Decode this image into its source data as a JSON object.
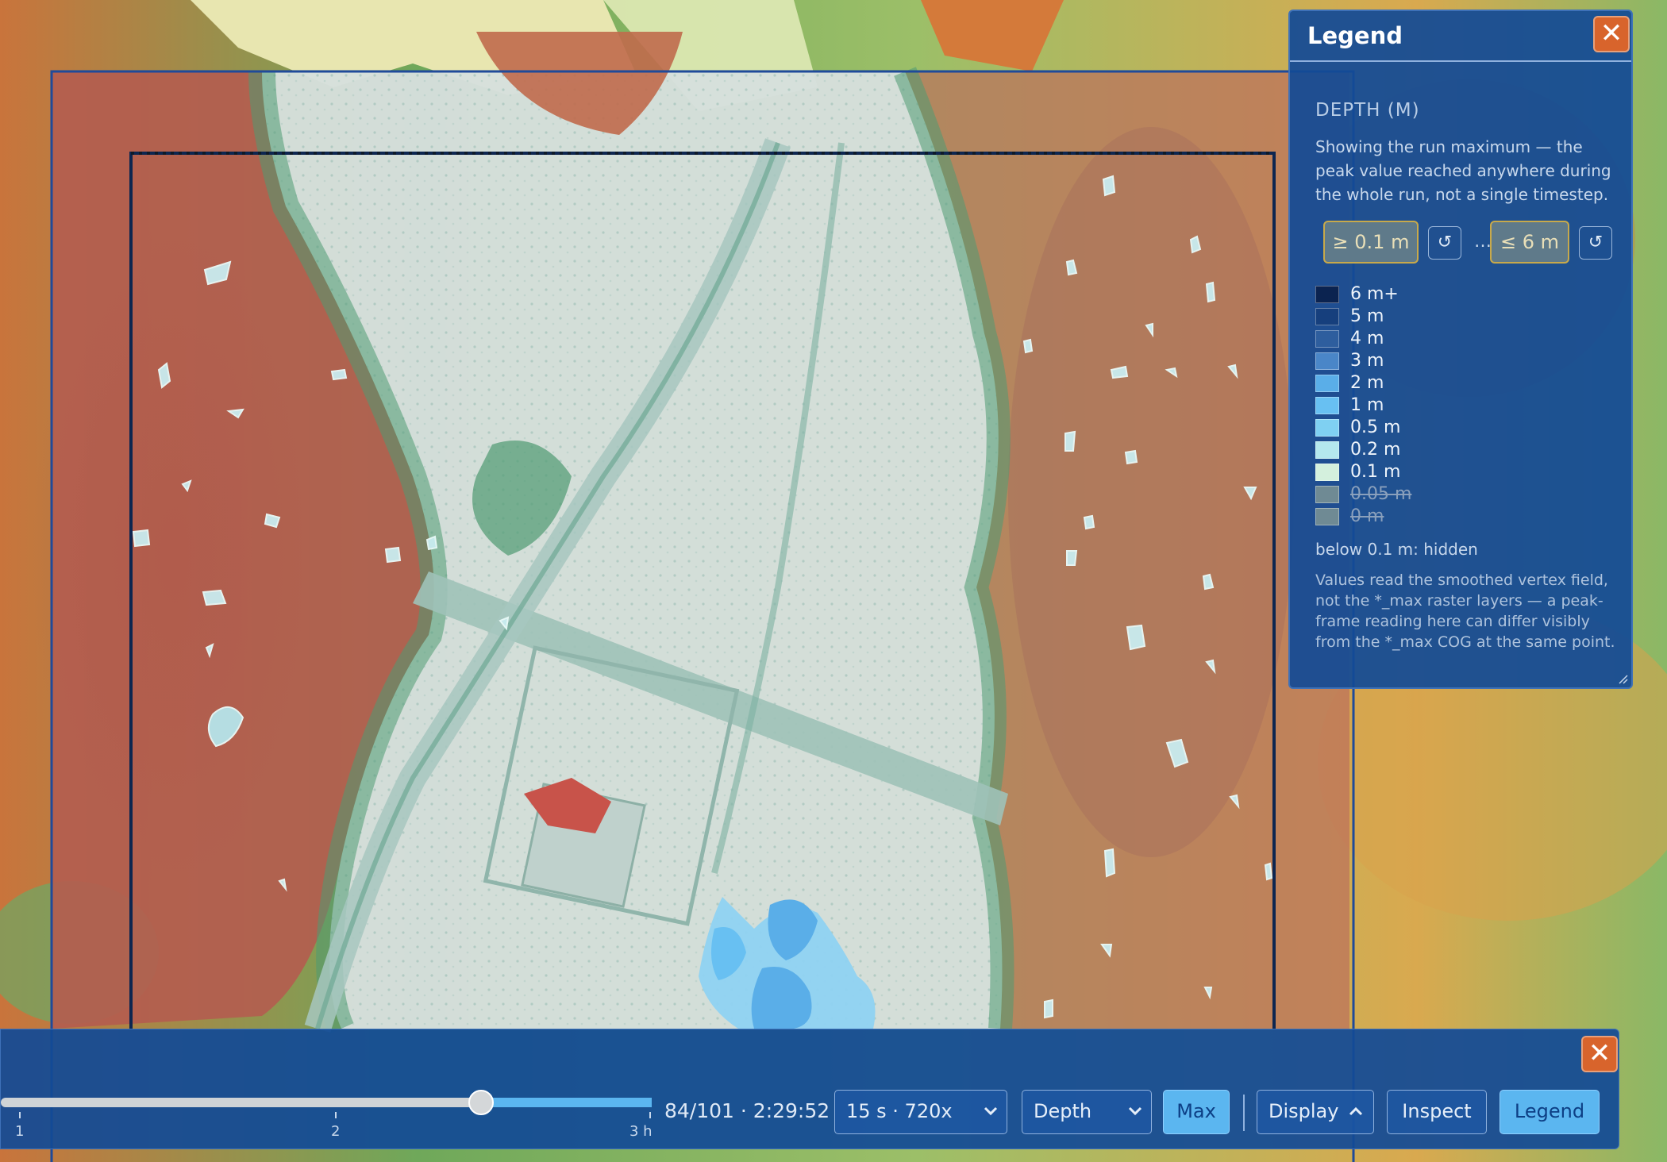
{
  "legend": {
    "title": "Legend",
    "section_title": "DEPTH (M)",
    "description": "Showing the run maximum — the peak value reached anywhere during the whole run, not a single timestep.",
    "min_filter": "≥ 0.1 m",
    "max_filter": "≤ 6 m",
    "ellipsis": "…",
    "reset_symbol": "↺",
    "items": [
      {
        "label": "6 m+",
        "color": "#0b2350",
        "enabled": true
      },
      {
        "label": "5 m",
        "color": "#163f7d",
        "enabled": true
      },
      {
        "label": "4 m",
        "color": "#2e5e9e",
        "enabled": true
      },
      {
        "label": "3 m",
        "color": "#4a86c8",
        "enabled": true
      },
      {
        "label": "2 m",
        "color": "#5aaee8",
        "enabled": true
      },
      {
        "label": "1 m",
        "color": "#68c0f2",
        "enabled": true
      },
      {
        "label": "0.5 m",
        "color": "#7fd0f2",
        "enabled": true
      },
      {
        "label": "0.2 m",
        "color": "#b4e8ee",
        "enabled": true
      },
      {
        "label": "0.1 m",
        "color": "#d4f0dd",
        "enabled": true
      },
      {
        "label": "0.05 m",
        "color": "#6f8a94",
        "enabled": false
      },
      {
        "label": "0 m",
        "color": "#6f8a94",
        "enabled": false
      }
    ],
    "hidden_note": "below 0.1 m: hidden",
    "footnote": "Values read the smoothed vertex field, not the *_max raster layers — a peak-frame reading here can differ visibly from the *_max COG at the same point."
  },
  "playback": {
    "progress": 0.69,
    "ticks": [
      "1",
      "2",
      "3 h"
    ],
    "time_readout": "84/101 · 2:29:52",
    "speed_select": "15 s · 720x",
    "variable_select": "Depth",
    "max_label": "Max",
    "display_label": "Display",
    "inspect_label": "Inspect",
    "legend_label": "Legend"
  },
  "icons": {
    "close": "✕",
    "chevron_down": "chevron-down-icon",
    "chevron_up": "chevron-up-icon"
  }
}
